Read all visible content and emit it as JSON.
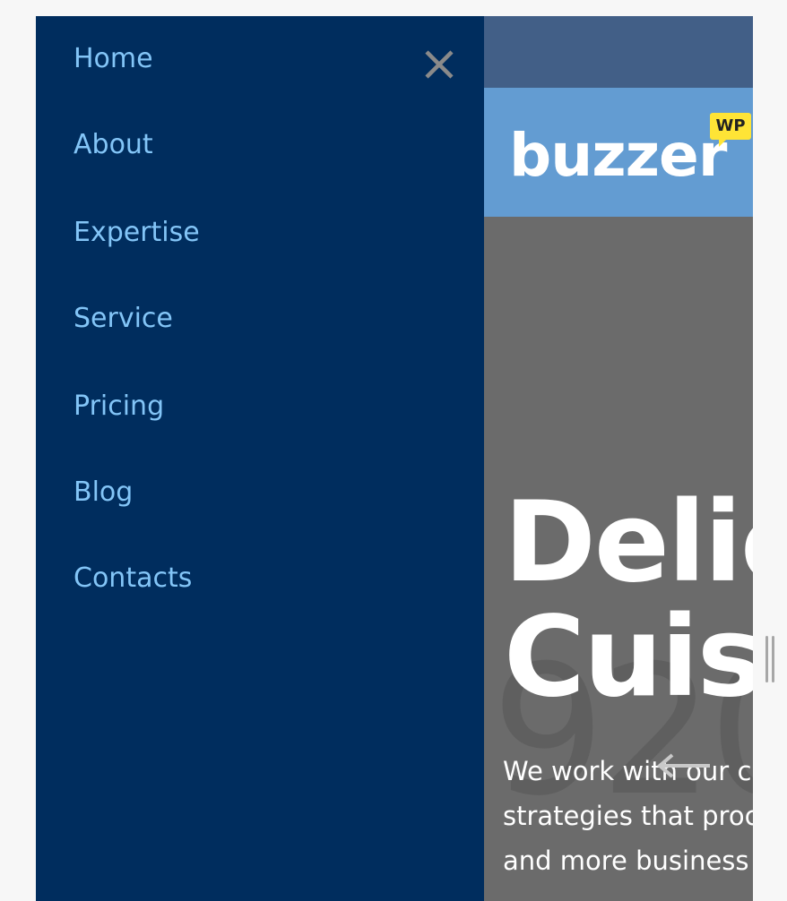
{
  "menu": {
    "items": [
      {
        "label": "Home"
      },
      {
        "label": "About"
      },
      {
        "label": "Expertise"
      },
      {
        "label": "Service"
      },
      {
        "label": "Pricing"
      },
      {
        "label": "Blog"
      },
      {
        "label": "Contacts"
      }
    ],
    "close_icon": "close-icon",
    "colors": {
      "background": "#002d5e",
      "link": "#83c5f7",
      "close": "#8a8a8a"
    }
  },
  "header": {
    "logo_text": "buzzer",
    "logo_badge": "WP",
    "colors": {
      "topbar": "#425f87",
      "logo_band": "#639cd2",
      "badge": "#ffe436"
    }
  },
  "hero": {
    "title_line1": "Delic",
    "title_line2": "Cuis",
    "background_number": "920",
    "text_lines": [
      "We work with our c",
      "strategies that proc",
      "and more business"
    ],
    "arrow_icon": "arrow-left-icon",
    "colors": {
      "background": "#6b6b6b",
      "text": "#ffffff"
    }
  },
  "scrollbar": {
    "icon": "drag-handle-icon"
  }
}
